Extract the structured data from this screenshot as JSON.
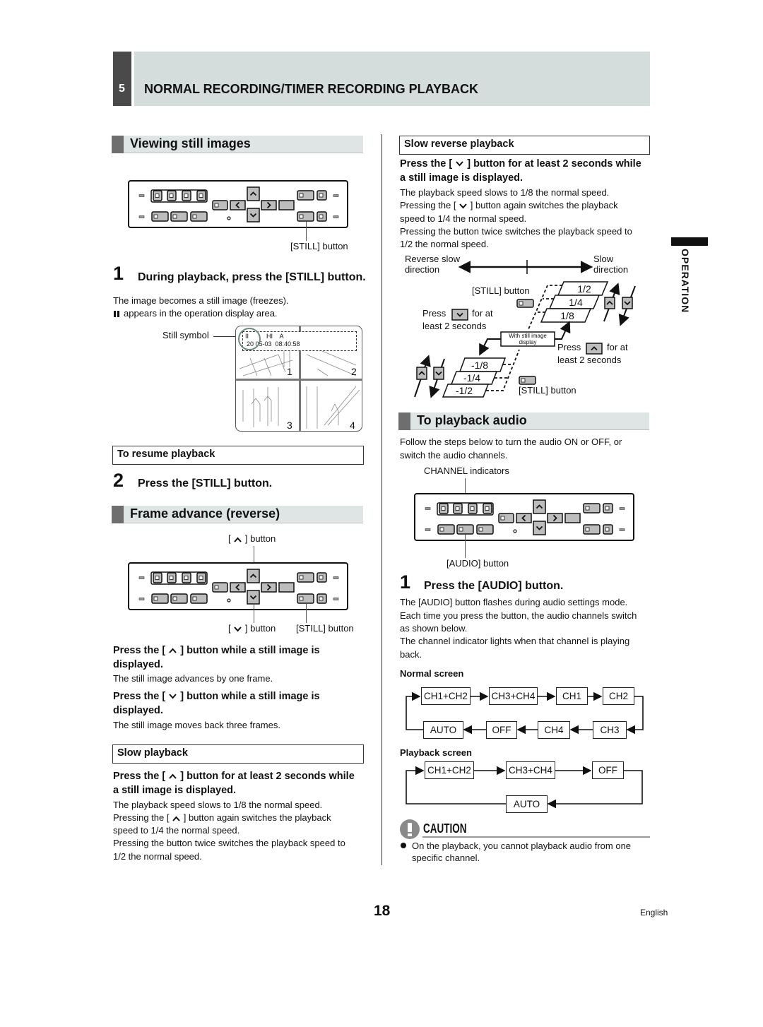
{
  "header": {
    "chapter": "5",
    "title": "NORMAL RECORDING/TIMER RECORDING PLAYBACK"
  },
  "side_tab": "OPERATION",
  "left": {
    "viewing": {
      "title": "Viewing still images",
      "still_button_label": "[STILL] button",
      "step_num": "1",
      "step": "During playback, press the [STILL] button.",
      "desc1": "The image becomes a still image (freezes).",
      "desc2": "appears in the operation display area.",
      "still_symbol_label": "Still symbol",
      "screen": {
        "osd_line1": "II          HI    A",
        "osd_line2": "20 05-03  08:40:58",
        "cams": [
          "1",
          "2",
          "3",
          "4"
        ]
      }
    },
    "resume": {
      "title": "To resume playback",
      "step_num": "2",
      "step": "Press the [STILL] button."
    },
    "frame": {
      "title": "Frame advance (reverse)",
      "up_label": "] button",
      "down_label": "] button",
      "still_label": "[STILL] button",
      "p1a": "Press the [",
      "p1b": "] button while a still image is",
      "p1c": "displayed.",
      "p1d": "The still image advances by one frame.",
      "p2a": "Press the [",
      "p2b": "] button while a still image is",
      "p2c": "displayed.",
      "p2d": "The still image moves back three frames."
    },
    "slow": {
      "title": "Slow playback",
      "b1a": "Press the [",
      "b1b": "] button for at least 2 seconds while",
      "b2": "a still image is displayed.",
      "l1": "The playback speed slows to 1/8 the normal speed.",
      "l2a": "Pressing the [",
      "l2b": "] button again switches the playback",
      "l3": "speed to 1/4 the normal speed.",
      "l4": "Pressing the button twice switches the playback speed to",
      "l5": "1/2 the normal speed."
    }
  },
  "right": {
    "slow_rev": {
      "title": "Slow reverse playback",
      "b1a": "Press the [",
      "b1b": "] button for at least 2 seconds while",
      "b2": "a still image is displayed.",
      "l1": "The playback speed slows to 1/8 the normal speed.",
      "l2a": "Pressing the [",
      "l2b": "] button again switches the playback",
      "l3": "speed to 1/4 the normal speed.",
      "l4": "Pressing the button twice switches the playback speed to",
      "l5": "1/2 the normal speed.",
      "diagram": {
        "rev_dir_1": "Reverse slow",
        "rev_dir_2": "direction",
        "fwd_dir_1": "Slow",
        "fwd_dir_2": "direction",
        "still_button": "[STILL] button",
        "press_down_1a": "Press",
        "press_down_1b": "for at",
        "press_down_2": "least 2 seconds",
        "press_up_1a": "Press",
        "press_up_1b": "for at",
        "press_up_2": "least 2 seconds",
        "still_display_1": "With still image",
        "still_display_2": "display",
        "fwd_speeds": [
          "1/2",
          "1/4",
          "1/8"
        ],
        "rev_speeds": [
          "-1/8",
          "-1/4",
          "-1/2"
        ]
      }
    },
    "audio": {
      "title": "To playback audio",
      "intro1": "Follow the steps below to turn the audio ON or OFF, or",
      "intro2": "switch the audio channels.",
      "channel_label": "CHANNEL indicators",
      "audio_button_label": "[AUDIO] button",
      "step_num": "1",
      "step": "Press the [AUDIO] button.",
      "d1": "The [AUDIO] button flashes during audio settings mode.",
      "d2": "Each time you press the button, the audio channels switch",
      "d3": "as shown below.",
      "d4": "The channel indicator lights when that channel is playing",
      "d5": "back.",
      "normal_title": "Normal screen",
      "normal_top": [
        "CH1+CH2",
        "CH3+CH4",
        "CH1",
        "CH2"
      ],
      "normal_bottom": [
        "AUTO",
        "OFF",
        "CH4",
        "CH3"
      ],
      "playback_title": "Playback screen",
      "playback_top": [
        "CH1+CH2",
        "CH3+CH4",
        "OFF"
      ],
      "playback_bottom": [
        "AUTO"
      ]
    },
    "caution": {
      "title": "CAUTION",
      "b1": "On the playback, you cannot playback audio from one",
      "b2": "specific channel."
    }
  },
  "footer": {
    "page": "18",
    "lang": "English"
  },
  "colors": {
    "header_dark": "#4a4a4a",
    "header_band": "#d4dcdc",
    "section_bar": "#dfe5e5"
  }
}
